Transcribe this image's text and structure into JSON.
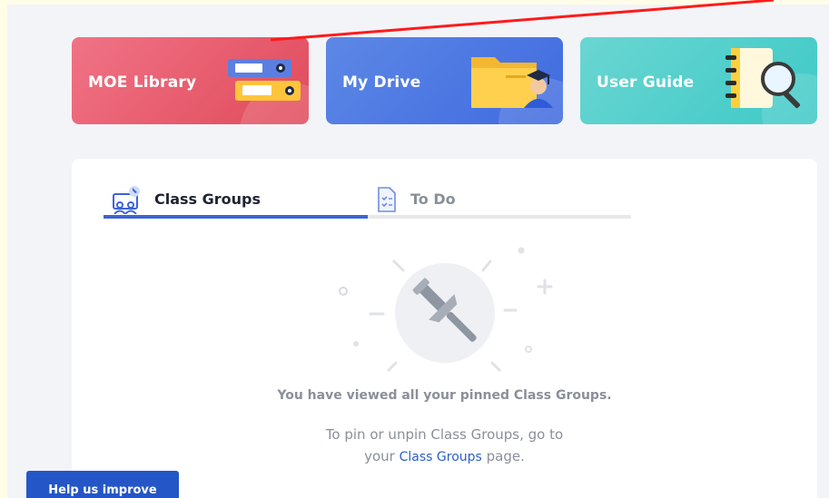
{
  "cards": {
    "moe_library": {
      "label": "MOE Library",
      "icon": "binders-icon"
    },
    "my_drive": {
      "label": "My Drive",
      "icon": "folder-graduate-icon"
    },
    "user_guide": {
      "label": "User Guide",
      "icon": "notebook-magnifier-icon"
    }
  },
  "tabs": [
    {
      "label": "Class Groups",
      "icon": "class-group-pin-icon",
      "active": true
    },
    {
      "label": "To Do",
      "icon": "checklist-icon",
      "active": false
    }
  ],
  "empty_state": {
    "title": "You have viewed all your pinned Class Groups.",
    "desc_line1": "To pin or unpin Class Groups, go to",
    "desc_prefix": "your",
    "link": "Class Groups",
    "desc_suffix": "page.",
    "icon": "pushpin-icon"
  },
  "feedback": {
    "label": "Help us improve"
  },
  "colors": {
    "moe_card": "#e65a6a",
    "drive_card": "#4d79e2",
    "guide_card": "#52cfcc",
    "tab_active": "#3e64d4",
    "link": "#2d5ec9",
    "help_button": "#2456c7"
  }
}
